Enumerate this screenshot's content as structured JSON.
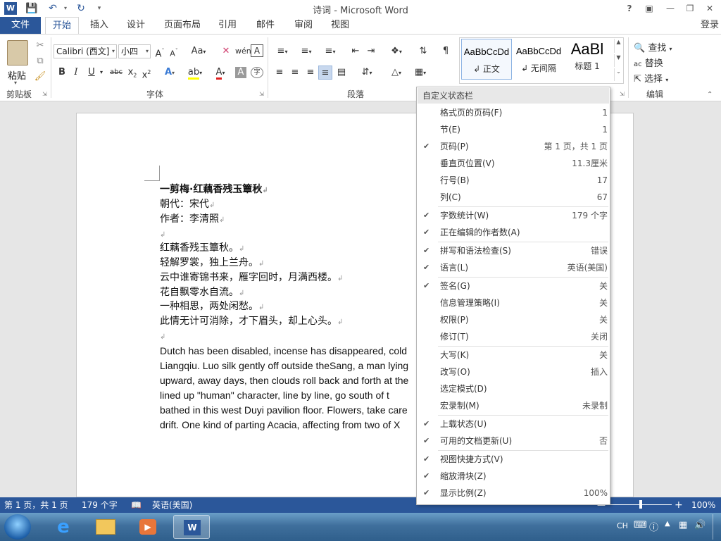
{
  "window": {
    "title": "诗词 - Microsoft Word",
    "signin": "登录"
  },
  "quick_access": {
    "word_icon": "word-icon",
    "save_icon": "save-icon",
    "undo_icon": "undo-icon",
    "redo_icon": "redo-icon",
    "customize_icon": "customize-qat-icon"
  },
  "tabs": [
    {
      "label": "文件"
    },
    {
      "label": "开始"
    },
    {
      "label": "插入"
    },
    {
      "label": "设计"
    },
    {
      "label": "页面布局"
    },
    {
      "label": "引用"
    },
    {
      "label": "邮件"
    },
    {
      "label": "审阅"
    },
    {
      "label": "视图"
    }
  ],
  "ribbon": {
    "clipboard": {
      "paste": "粘贴",
      "label": "剪贴板"
    },
    "font": {
      "name": "Calibri (西文]",
      "size": "小四",
      "label": "字体"
    },
    "paragraph": {
      "label": "段落"
    },
    "styles": {
      "items": [
        {
          "sample": "AaBbCcDd",
          "name": "↲ 正文"
        },
        {
          "sample": "AaBbCcDd",
          "name": "↲ 无间隔"
        },
        {
          "sample": "AaBl",
          "name": "标题 1"
        }
      ]
    },
    "editing": {
      "find": "查找",
      "replace": "替换",
      "select": "选择",
      "label": "编辑"
    }
  },
  "document": {
    "lines": [
      "一剪梅·红藕香残玉簟秋",
      "朝代：宋代",
      "作者：李清照",
      "",
      "红藕香残玉簟秋。",
      "轻解罗裳，独上兰舟。",
      "云中谁寄锦书来，雁字回时，月满西楼。",
      "花自飘零水自流。",
      "一种相思，两处闲愁。",
      "此情无计可消除，才下眉头，却上心头。",
      ""
    ],
    "english": [
      "Dutch has been disabled, incense has disappeared, cold",
      "Liangqiu. Luo silk gently off outside theSang, a man lying",
      "upward, away days, then clouds roll back and forth at the",
      "lined up \"human\" character, line by line, go south of t",
      "bathed in this west Duyi pavilion floor. Flowers, take care",
      "drift. One kind of parting Acacia, affecting from two of X"
    ]
  },
  "status_menu": {
    "header": "自定义状态栏",
    "items": [
      {
        "checked": false,
        "label": "格式页的页码(F)",
        "value": "1"
      },
      {
        "checked": false,
        "label": "节(E)",
        "value": "1"
      },
      {
        "checked": true,
        "label": "页码(P)",
        "value": "第 1 页，共 1 页"
      },
      {
        "checked": false,
        "label": "垂直页位置(V)",
        "value": "11.3厘米"
      },
      {
        "checked": false,
        "label": "行号(B)",
        "value": "17"
      },
      {
        "checked": false,
        "label": "列(C)",
        "value": "67"
      },
      {
        "checked": true,
        "label": "字数统计(W)",
        "value": "179 个字"
      },
      {
        "checked": true,
        "label": "正在编辑的作者数(A)",
        "value": ""
      },
      {
        "checked": true,
        "label": "拼写和语法检查(S)",
        "value": "错误"
      },
      {
        "checked": true,
        "label": "语言(L)",
        "value": "英语(美国)"
      },
      {
        "checked": true,
        "label": "签名(G)",
        "value": "关"
      },
      {
        "checked": false,
        "label": "信息管理策略(I)",
        "value": "关"
      },
      {
        "checked": false,
        "label": "权限(P)",
        "value": "关"
      },
      {
        "checked": false,
        "label": "修订(T)",
        "value": "关闭"
      },
      {
        "checked": false,
        "label": "大写(K)",
        "value": "关"
      },
      {
        "checked": false,
        "label": "改写(O)",
        "value": "插入"
      },
      {
        "checked": false,
        "label": "选定模式(D)",
        "value": ""
      },
      {
        "checked": false,
        "label": "宏录制(M)",
        "value": "未录制"
      },
      {
        "checked": true,
        "label": "上载状态(U)",
        "value": ""
      },
      {
        "checked": true,
        "label": "可用的文档更新(U)",
        "value": "否"
      },
      {
        "checked": true,
        "label": "视图快捷方式(V)",
        "value": ""
      },
      {
        "checked": true,
        "label": "缩放滑块(Z)",
        "value": ""
      },
      {
        "checked": true,
        "label": "显示比例(Z)",
        "value": "100%"
      }
    ]
  },
  "status_bar": {
    "page": "第 1 页，共 1 页",
    "words": "179 个字",
    "language": "英语(美国)",
    "zoom": "100%",
    "zoom_level": 0.5
  },
  "taskbar": {
    "ime": "CH",
    "apps": [
      "start-orb-icon",
      "ie-icon",
      "explorer-icon",
      "media-player-icon",
      "word-icon"
    ]
  },
  "colors": {
    "accent": "#2b579a",
    "font_color_underline": "#e02020",
    "highlight": "#ffff00"
  }
}
